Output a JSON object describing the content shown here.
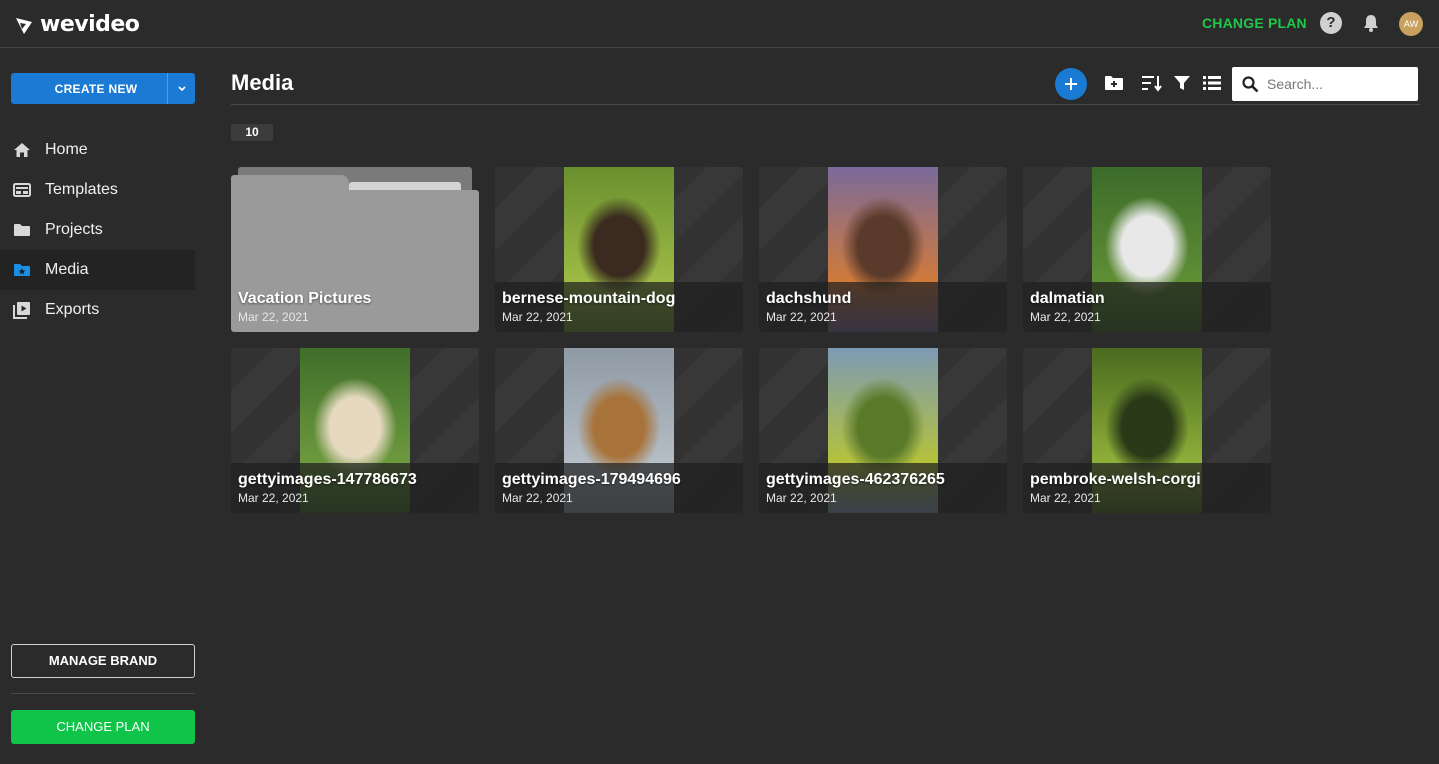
{
  "app": {
    "logo_text": "wevideo"
  },
  "header": {
    "change_plan": "CHANGE PLAN",
    "help": "?",
    "avatar_initials": "AW"
  },
  "sidebar": {
    "create_new": "CREATE NEW",
    "items": [
      {
        "label": "Home",
        "icon": "home-icon"
      },
      {
        "label": "Templates",
        "icon": "templates-icon"
      },
      {
        "label": "Projects",
        "icon": "folder-icon"
      },
      {
        "label": "Media",
        "icon": "media-icon",
        "active": true
      },
      {
        "label": "Exports",
        "icon": "exports-icon"
      }
    ],
    "manage_brand": "MANAGE BRAND",
    "change_plan": "CHANGE PLAN"
  },
  "main": {
    "title": "Media",
    "count": "10",
    "search_placeholder": "Search...",
    "items": [
      {
        "type": "folder",
        "name": "Vacation Pictures",
        "date": "Mar 22, 2021"
      },
      {
        "type": "image",
        "name": "bernese-mountain-dog",
        "date": "Mar 22, 2021",
        "colors": [
          "#6a8f2e",
          "#9dbb45",
          "#3a2a1f"
        ]
      },
      {
        "type": "image",
        "name": "dachshund",
        "date": "Mar 22, 2021",
        "colors": [
          "#7a6a9a",
          "#d07a3a",
          "#5a3a2a"
        ]
      },
      {
        "type": "image",
        "name": "dalmatian",
        "date": "Mar 22, 2021",
        "colors": [
          "#3c6b2a",
          "#5f8f35",
          "#e8e8e8"
        ]
      },
      {
        "type": "image",
        "name": "gettyimages-147786673",
        "date": "Mar 22, 2021",
        "colors": [
          "#3f6e2a",
          "#6d9a3e",
          "#e6d9c0"
        ]
      },
      {
        "type": "image",
        "name": "gettyimages-179494696",
        "date": "Mar 22, 2021",
        "colors": [
          "#8f9aa5",
          "#b5bec6",
          "#a8733a"
        ]
      },
      {
        "type": "image",
        "name": "gettyimages-462376265",
        "date": "Mar 22, 2021",
        "colors": [
          "#7d9ab5",
          "#b5c23a",
          "#5a7a2a"
        ]
      },
      {
        "type": "image",
        "name": "pembroke-welsh-corgi",
        "date": "Mar 22, 2021",
        "colors": [
          "#4a6a1f",
          "#8fb03a",
          "#2a3a18"
        ]
      }
    ]
  }
}
